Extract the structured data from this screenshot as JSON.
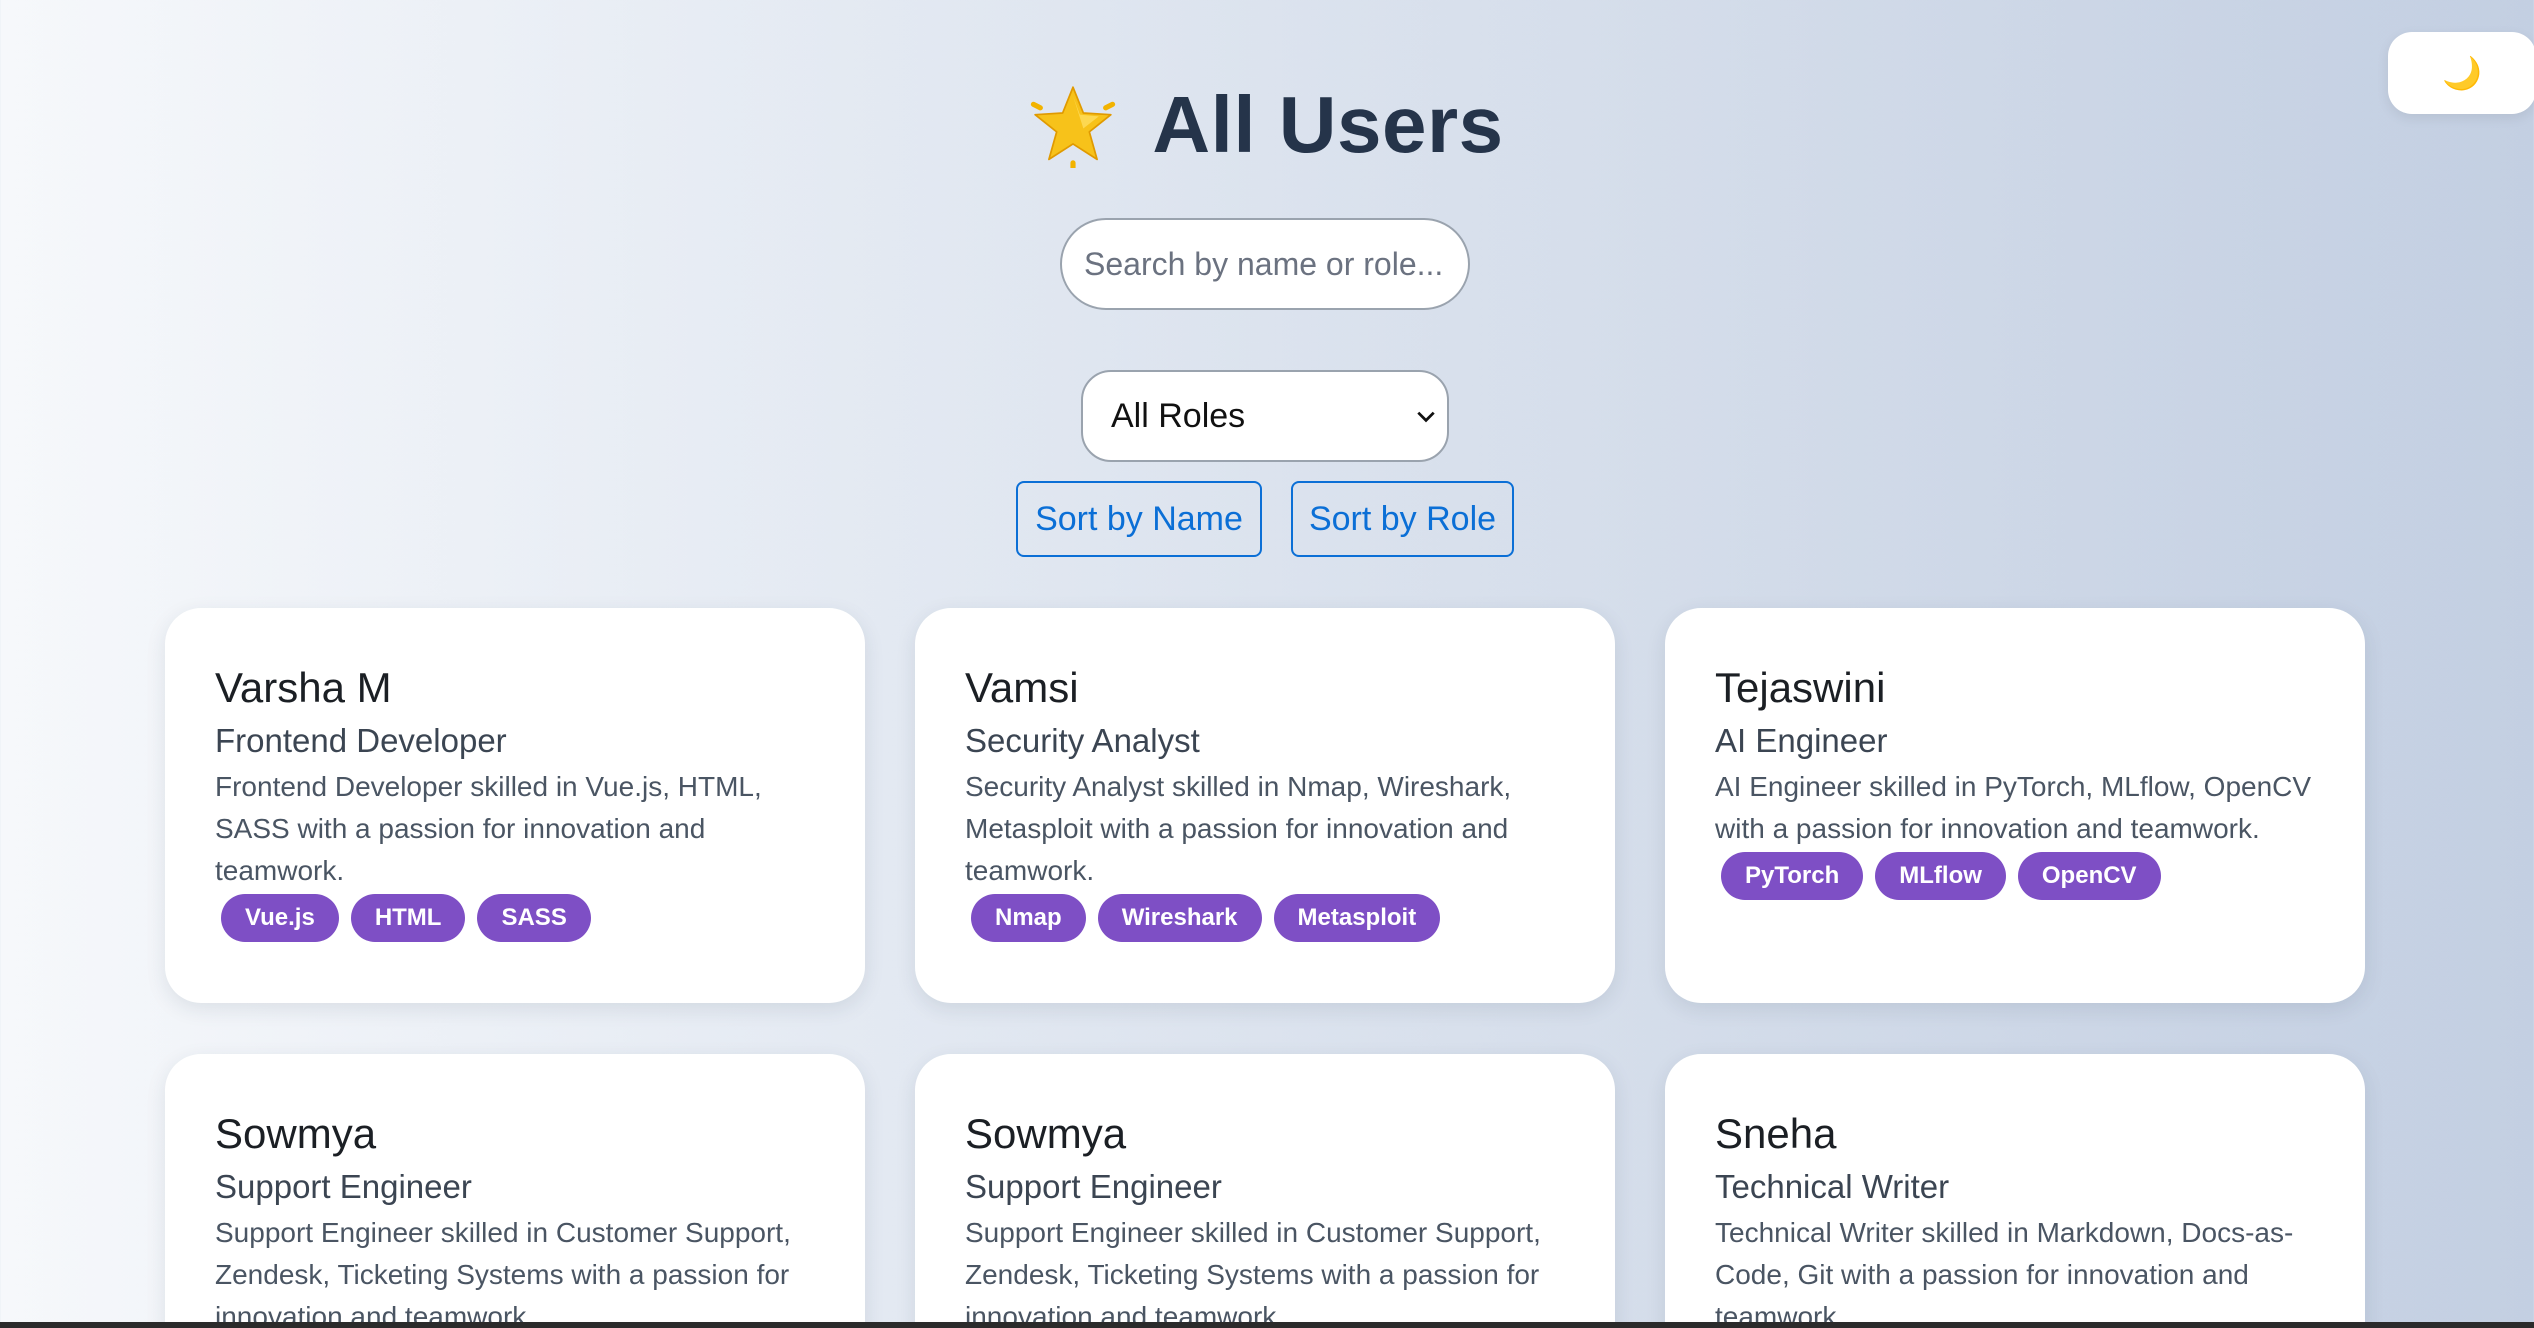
{
  "header": {
    "title": "All Users",
    "icon": "star-icon"
  },
  "theme_toggle": {
    "icon": "moon-icon",
    "glyph": "🌙"
  },
  "search": {
    "placeholder": "Search by name or role...",
    "value": ""
  },
  "filter": {
    "selected": "All Roles"
  },
  "sort": {
    "by_name_label": "Sort by Name",
    "by_role_label": "Sort by Role"
  },
  "users": [
    {
      "name": "Varsha M",
      "role": "Frontend Developer",
      "description": "Frontend Developer skilled in Vue.js, HTML, SASS with a passion for innovation and teamwork.",
      "skills": [
        "Vue.js",
        "HTML",
        "SASS"
      ]
    },
    {
      "name": "Vamsi",
      "role": "Security Analyst",
      "description": "Security Analyst skilled in Nmap, Wireshark, Metasploit with a passion for innovation and teamwork.",
      "skills": [
        "Nmap",
        "Wireshark",
        "Metasploit"
      ]
    },
    {
      "name": "Tejaswini",
      "role": "AI Engineer",
      "description": "AI Engineer skilled in PyTorch, MLflow, OpenCV with a passion for innovation and teamwork.",
      "skills": [
        "PyTorch",
        "MLflow",
        "OpenCV"
      ]
    },
    {
      "name": "Sowmya",
      "role": "Support Engineer",
      "description": "Support Engineer skilled in Customer Support, Zendesk, Ticketing Systems with a passion for innovation and teamwork."
    },
    {
      "name": "Sowmya",
      "role": "Support Engineer",
      "description": "Support Engineer skilled in Customer Support, Zendesk, Ticketing Systems with a passion for innovation and teamwork."
    },
    {
      "name": "Sneha",
      "role": "Technical Writer",
      "description": "Technical Writer skilled in Markdown, Docs-as-Code, Git with a passion for innovation and teamwork."
    }
  ],
  "colors": {
    "tag_bg": "#7e4fc5",
    "accent": "#0b6fd6",
    "title": "#25344a"
  }
}
